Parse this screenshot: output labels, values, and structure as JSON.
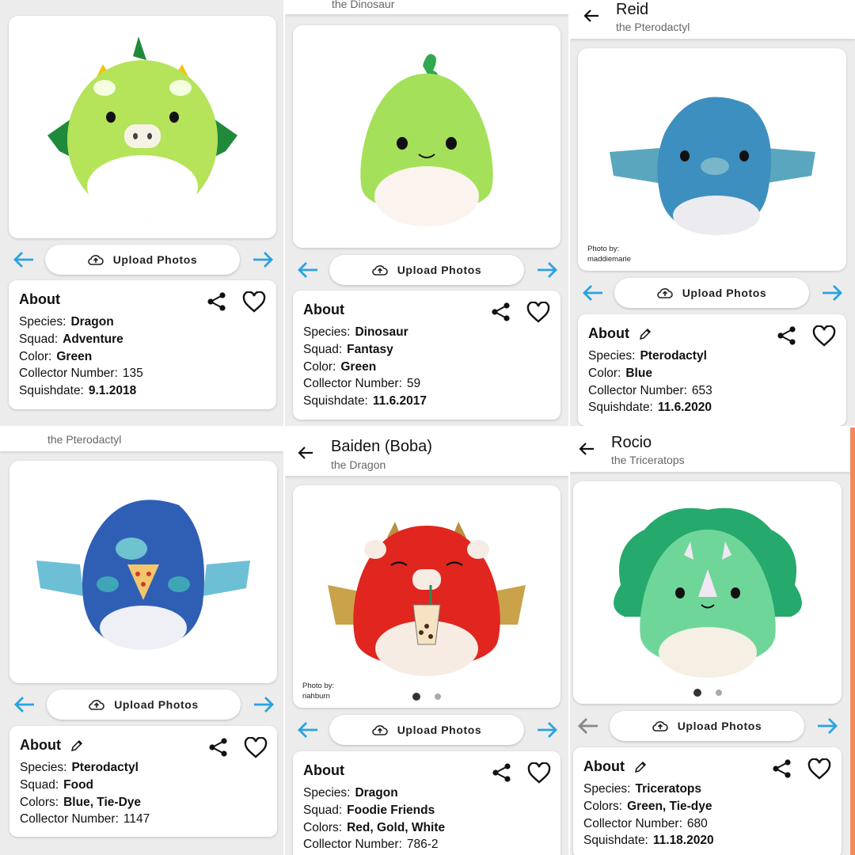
{
  "panels": [
    {
      "id": "dragon-green",
      "title": "",
      "subtitle": "",
      "photo_credit": null,
      "show_dots": false,
      "actions": {
        "upload_label": "Upload Photos"
      },
      "about": {
        "title": "About",
        "editable": false,
        "rows": [
          {
            "key": "Species:",
            "value": "Dragon",
            "bold": true
          },
          {
            "key": "Squad:",
            "value": "Adventure",
            "bold": true
          },
          {
            "key": "Color:",
            "value": "Green",
            "bold": true
          },
          {
            "key": "Collector Number:",
            "value": "135",
            "bold": false
          },
          {
            "key": "Squishdate:",
            "value": "9.1.2018",
            "bold": true
          }
        ]
      }
    },
    {
      "id": "dinosaur-green",
      "title": "",
      "subtitle": "the Dinosaur",
      "photo_credit": null,
      "show_dots": false,
      "actions": {
        "upload_label": "Upload Photos"
      },
      "about": {
        "title": "About",
        "editable": false,
        "rows": [
          {
            "key": "Species:",
            "value": "Dinosaur",
            "bold": true
          },
          {
            "key": "Squad:",
            "value": "Fantasy",
            "bold": true
          },
          {
            "key": "Color:",
            "value": "Green",
            "bold": true
          },
          {
            "key": "Collector Number:",
            "value": "59",
            "bold": false
          },
          {
            "key": "Squishdate:",
            "value": "11.6.2017",
            "bold": true
          }
        ]
      }
    },
    {
      "id": "reid",
      "title": "Reid",
      "subtitle": "the Pterodactyl",
      "photo_credit": {
        "label": "Photo by:",
        "name": "maddiemarie"
      },
      "show_dots": false,
      "actions": {
        "upload_label": "Upload Photos"
      },
      "about": {
        "title": "About",
        "editable": true,
        "rows": [
          {
            "key": "Species:",
            "value": "Pterodactyl",
            "bold": true
          },
          {
            "key": "Color:",
            "value": "Blue",
            "bold": true
          },
          {
            "key": "Collector Number:",
            "value": "653",
            "bold": false
          },
          {
            "key": "Squishdate:",
            "value": "11.6.2020",
            "bold": true
          }
        ]
      }
    },
    {
      "id": "pterodactyl-pizza",
      "title": "",
      "subtitle": "the Pterodactyl",
      "photo_credit": null,
      "show_dots": false,
      "actions": {
        "upload_label": "Upload Photos"
      },
      "about": {
        "title": "About",
        "editable": true,
        "rows": [
          {
            "key": "Species:",
            "value": "Pterodactyl",
            "bold": true
          },
          {
            "key": "Squad:",
            "value": "Food",
            "bold": true
          },
          {
            "key": "Colors:",
            "value": "Blue, Tie-Dye",
            "bold": true
          },
          {
            "key": "Collector Number:",
            "value": "1147",
            "bold": false
          }
        ]
      }
    },
    {
      "id": "baiden",
      "title": "Baiden (Boba)",
      "subtitle": "the Dragon",
      "photo_credit": {
        "label": "Photo by:",
        "name": "riahburn"
      },
      "show_dots": true,
      "actions": {
        "upload_label": "Upload Photos"
      },
      "about": {
        "title": "About",
        "editable": false,
        "rows": [
          {
            "key": "Species:",
            "value": "Dragon",
            "bold": true
          },
          {
            "key": "Squad:",
            "value": "Foodie Friends",
            "bold": true
          },
          {
            "key": "Colors:",
            "value": "Red, Gold, White",
            "bold": true
          },
          {
            "key": "Collector Number:",
            "value": "786-2",
            "bold": false
          }
        ]
      }
    },
    {
      "id": "rocio",
      "title": "Rocio",
      "subtitle": "the Triceratops",
      "photo_credit": null,
      "show_dots": true,
      "actions": {
        "upload_label": "Upload Photos"
      },
      "about": {
        "title": "About",
        "editable": true,
        "rows": [
          {
            "key": "Species:",
            "value": "Triceratops",
            "bold": true
          },
          {
            "key": "Colors:",
            "value": "Green, Tie-dye",
            "bold": true
          },
          {
            "key": "Collector Number:",
            "value": "680",
            "bold": false
          },
          {
            "key": "Squishdate:",
            "value": "11.18.2020",
            "bold": true
          }
        ]
      }
    }
  ],
  "icons": {
    "back": "arrow-left-icon",
    "prev": "arrow-left-icon",
    "next": "arrow-right-icon",
    "upload": "cloud-upload-icon",
    "share": "share-icon",
    "favorite": "heart-outline-icon",
    "edit": "pencil-icon"
  },
  "colors": {
    "nav_arrow": "#29a3e0",
    "nav_arrow_disabled": "#888888",
    "background": "#ececec",
    "card": "#ffffff",
    "accent_edge": "#f08a5d"
  }
}
